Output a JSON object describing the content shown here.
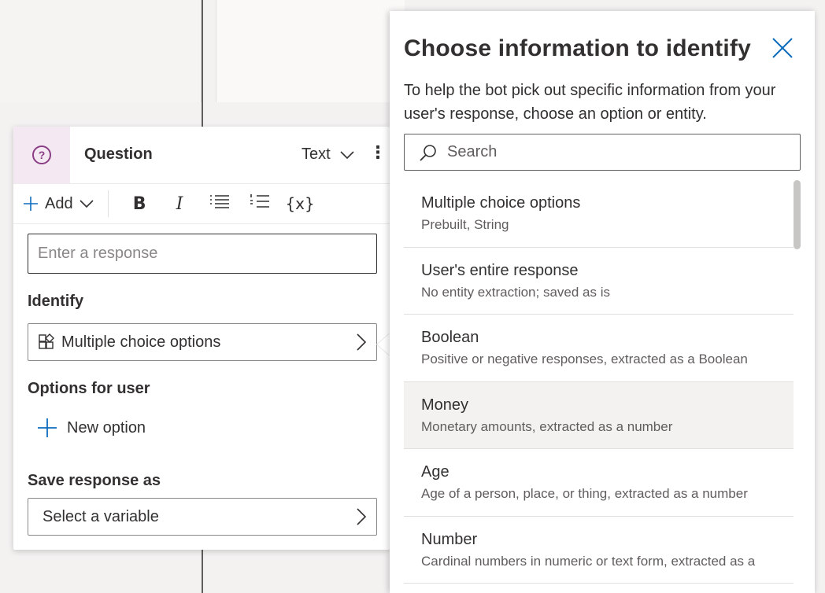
{
  "question_node": {
    "icon": "question-circle-icon",
    "title": "Question",
    "type_label": "Text",
    "toolbar": {
      "add_label": "Add",
      "bold_label": "B",
      "italic_label": "I",
      "variable_label": "{x}"
    },
    "response_placeholder": "Enter a response",
    "identify_label": "Identify",
    "identify_value": "Multiple choice options",
    "options_label": "Options for user",
    "new_option_label": "New option",
    "save_label": "Save response as",
    "variable_placeholder": "Select a variable"
  },
  "panel": {
    "title": "Choose information to identify",
    "description": "To help the bot pick out specific information from your user's response, choose an option or entity.",
    "search_placeholder": "Search",
    "entities": [
      {
        "name": "Multiple choice options",
        "desc": "Prebuilt, String",
        "selected": false
      },
      {
        "name": "User's entire response",
        "desc": "No entity extraction; saved as is",
        "selected": false
      },
      {
        "name": "Boolean",
        "desc": "Positive or negative responses, extracted as a Boolean",
        "selected": false
      },
      {
        "name": "Money",
        "desc": "Monetary amounts, extracted as a number",
        "selected": true
      },
      {
        "name": "Age",
        "desc": "Age of a person, place, or thing, extracted as a number",
        "selected": false
      },
      {
        "name": "Number",
        "desc": "Cardinal numbers in numeric or text form, extracted as a",
        "selected": false
      }
    ]
  },
  "colors": {
    "accent": "#0f6cbd",
    "question_icon": "#8a3d84",
    "selected_row": "#f3f2f1"
  }
}
